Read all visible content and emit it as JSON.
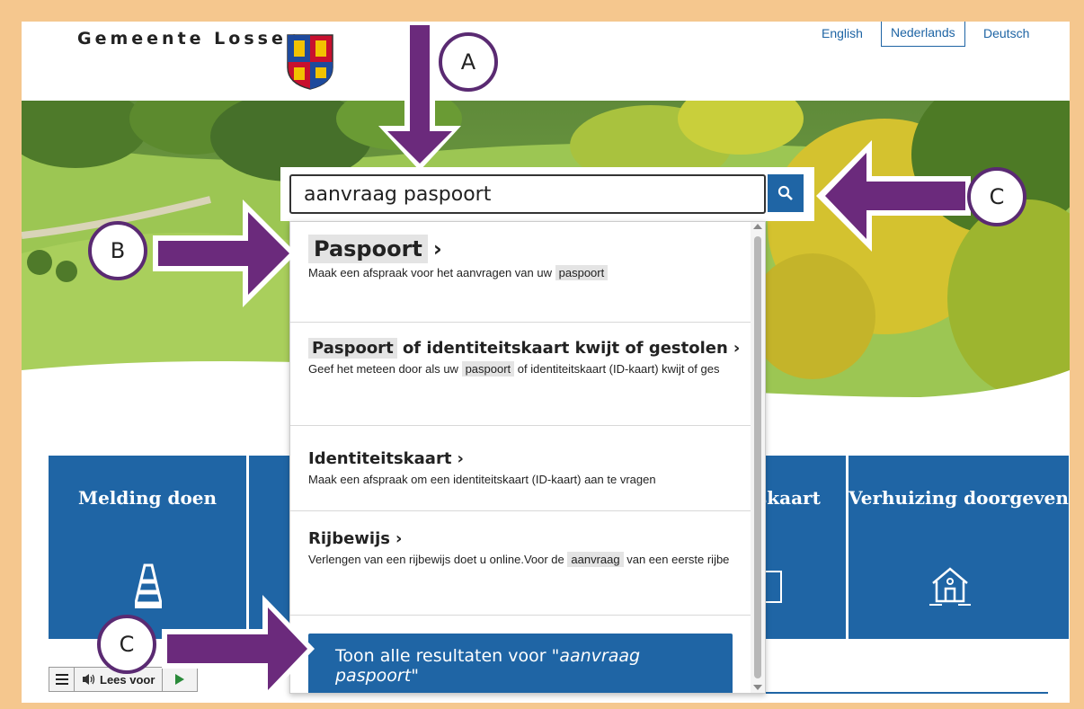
{
  "header": {
    "brand": "Gemeente Losser",
    "languages": [
      "English",
      "Nederlands",
      "Deutsch"
    ]
  },
  "search": {
    "value": "aanvraag paspoort"
  },
  "results": [
    {
      "title_highlight": "Paspoort",
      "title_rest": "",
      "desc_before": "Maak een afspraak voor het aanvragen van uw",
      "desc_highlight": "paspoort",
      "desc_after": ""
    },
    {
      "title_highlight": "Paspoort",
      "title_rest": " of identiteitskaart kwijt of gestolen",
      "desc_before": "Geef het meteen door als uw",
      "desc_highlight": "paspoort",
      "desc_after": "of identiteitskaart (ID-kaart) kwijt of ges"
    },
    {
      "title_highlight": "",
      "title_rest": "Identiteitskaart",
      "desc_before": "Maak een afspraak om een identiteitskaart (ID-kaart) aan te vragen",
      "desc_highlight": "",
      "desc_after": ""
    },
    {
      "title_highlight": "",
      "title_rest": "Rijbewijs",
      "desc_before": "Verlengen van een rijbewijs doet u online.Voor de",
      "desc_highlight": "aanvraag",
      "desc_after": "van een eerste rijbe"
    }
  ],
  "show_all": {
    "prefix": "Toon alle resultaten voor \"",
    "query": "aanvraag paspoort",
    "suffix": "\""
  },
  "tiles": [
    {
      "title": "Melding doen",
      "icon": "traffic-cone-icon"
    },
    {
      "title": "",
      "icon": ""
    },
    {
      "title": "skaart",
      "icon": ""
    },
    {
      "title": "Verhuizing doorgeven",
      "icon": "house-icon"
    }
  ],
  "readspeaker": {
    "label": "Lees voor"
  },
  "annotations": {
    "a": "A",
    "b": "B",
    "c1": "C",
    "c2": "C"
  },
  "colors": {
    "primary": "#1f65a5",
    "annotation": "#6b2a7c",
    "frame": "#f5c78e"
  }
}
